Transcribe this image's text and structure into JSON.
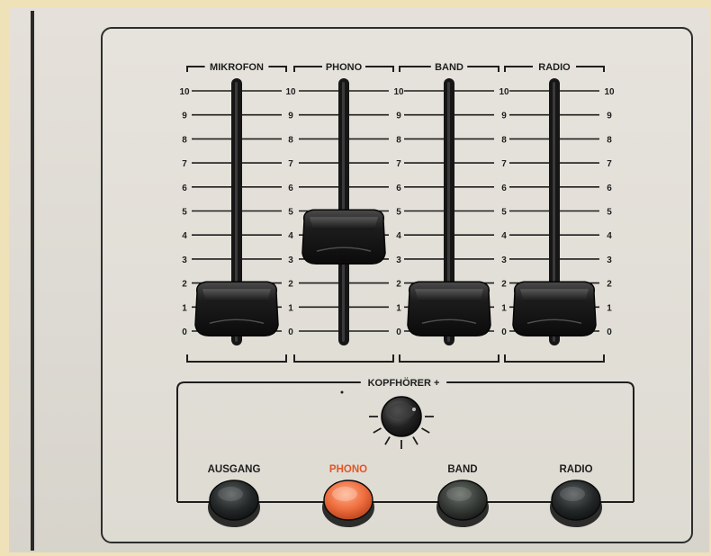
{
  "channels": [
    {
      "id": "mikrofon",
      "title": "MIKROFON",
      "level": 1,
      "knob_style": "dark"
    },
    {
      "id": "phono",
      "title": "PHONO",
      "level": 4,
      "knob_style": "dark"
    },
    {
      "id": "band",
      "title": "BAND",
      "level": 1,
      "knob_style": "dark"
    },
    {
      "id": "radio",
      "title": "RADIO",
      "level": 1,
      "knob_style": "dark"
    }
  ],
  "scale": [
    "0",
    "1",
    "2",
    "3",
    "4",
    "5",
    "6",
    "7",
    "8",
    "9",
    "10"
  ],
  "headphone": {
    "label": "KOPFHÖRER +"
  },
  "buttons": [
    {
      "id": "ausgang",
      "label": "AUSGANG",
      "active": false
    },
    {
      "id": "phono",
      "label": "PHONO",
      "active": true
    },
    {
      "id": "band",
      "label": "BAND",
      "active": false
    },
    {
      "id": "radio",
      "label": "RADIO",
      "active": false
    }
  ],
  "colors": {
    "panel": "#e3e0d9",
    "ink": "#1e1e1e",
    "knob": "#1a1a1a",
    "button_dark": "#232627",
    "button_band": "#3a3e3b",
    "button_active": "#ee6d3e"
  }
}
